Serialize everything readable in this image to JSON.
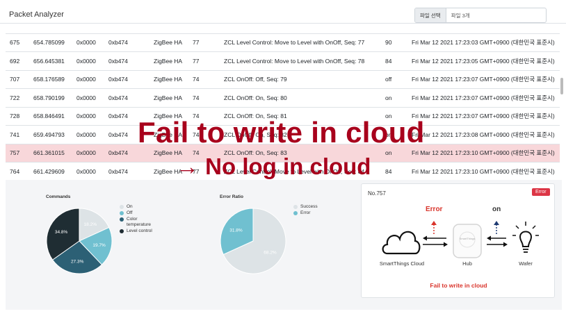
{
  "header": {
    "title": "Packet Analyzer",
    "file_button": "파일 선택",
    "file_name": "파일 3개"
  },
  "table": {
    "rows": [
      [
        "",
        "",
        "",
        "",
        "",
        "",
        "",
        "",
        ""
      ],
      [
        "675",
        "654.785099",
        "0x0000",
        "0xb474",
        "ZigBee HA",
        "77",
        "ZCL Level Control: Move to Level with OnOff, Seq: 77",
        "90",
        "Fri Mar 12 2021 17:23:03 GMT+0900 (대한민국 표준시)"
      ],
      [
        "692",
        "656.645381",
        "0x0000",
        "0xb474",
        "ZigBee HA",
        "77",
        "ZCL Level Control: Move to Level with OnOff, Seq: 78",
        "84",
        "Fri Mar 12 2021 17:23:05 GMT+0900 (대한민국 표준시)"
      ],
      [
        "707",
        "658.176589",
        "0x0000",
        "0xb474",
        "ZigBee HA",
        "74",
        "ZCL OnOff: Off, Seq: 79",
        "off",
        "Fri Mar 12 2021 17:23:07 GMT+0900 (대한민국 표준시)"
      ],
      [
        "722",
        "658.790199",
        "0x0000",
        "0xb474",
        "ZigBee HA",
        "74",
        "ZCL OnOff: On, Seq: 80",
        "on",
        "Fri Mar 12 2021 17:23:07 GMT+0900 (대한민국 표준시)"
      ],
      [
        "728",
        "658.846491",
        "0x0000",
        "0xb474",
        "ZigBee HA",
        "74",
        "ZCL OnOff: On, Seq: 81",
        "on",
        "Fri Mar 12 2021 17:23:07 GMT+0900 (대한민국 표준시)"
      ],
      [
        "741",
        "659.494793",
        "0x0000",
        "0xb474",
        "ZigBee HA",
        "74",
        "ZCL OnOff: On, Seq: 82",
        "on",
        "Fri Mar 12 2021 17:23:08 GMT+0900 (대한민국 표준시)"
      ],
      [
        "757",
        "661.361015",
        "0x0000",
        "0xb474",
        "ZigBee HA",
        "74",
        "ZCL OnOff: On, Seq: 83",
        "on",
        "Fri Mar 12 2021 17:23:10 GMT+0900 (대한민국 표준시)"
      ],
      [
        "764",
        "661.429609",
        "0x0000",
        "0xb474",
        "ZigBee HA",
        "77",
        "ZCL Level Control: Move to Level with OnOff, Seq: 84",
        "84",
        "Fri Mar 12 2021 17:23:10 GMT+0900 (대한민국 표준시)"
      ]
    ],
    "highlighted_row": 7
  },
  "chart_data": [
    {
      "type": "pie",
      "title": "Commands",
      "categories": [
        "On",
        "Off",
        "Color temperature",
        "Level control"
      ],
      "values": [
        18.2,
        19.7,
        27.3,
        34.8
      ],
      "labels": [
        "18.2%",
        "19.7%",
        "27.3%",
        "34.8%"
      ],
      "colors": [
        "#dde3e6",
        "#70c0d0",
        "#2c6075",
        "#1f2d33"
      ],
      "legend": "right"
    },
    {
      "type": "pie",
      "title": "Error Ratio",
      "categories": [
        "Success",
        "Error"
      ],
      "values": [
        68.2,
        31.8
      ],
      "labels": [
        "68.2%",
        "31.8%"
      ],
      "colors": [
        "#dde3e6",
        "#70c0d0"
      ],
      "legend": "right"
    }
  ],
  "detail": {
    "title": "No.757",
    "badge": "Error",
    "error_label": "Error",
    "state_label": "on",
    "cloud_label": "SmartThings Cloud",
    "hub_label": "Hub",
    "hub_logo": "SmartThings",
    "wafer_label": "Wafer",
    "fail_note": "Fail to write in cloud"
  },
  "overlay": {
    "line1": "Fail to write in cloud",
    "line2": "→ No log in cloud"
  },
  "colors": {
    "error_red": "#dc3545",
    "overlay_red": "#a8001c",
    "highlight_row": "#f8d7da"
  }
}
